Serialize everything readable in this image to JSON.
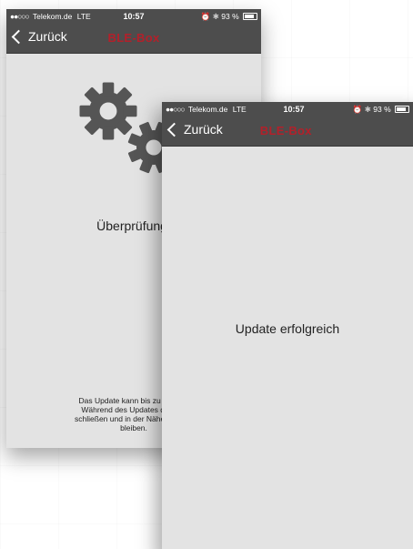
{
  "back_screen": {
    "status": {
      "signal_dots": "●●○○○",
      "carrier": "Telekom.de",
      "network": "LTE",
      "time": "10:57",
      "battery": "93 %"
    },
    "nav": {
      "back_label": "Zurück",
      "title": "BLE-Box"
    },
    "checking_text": "Überprüfung.",
    "note_lines": [
      "Das Update kann bis zu einer M",
      "Während des Updates die App",
      "schließen und in der Nähe der gev",
      "bleiben."
    ]
  },
  "front_screen": {
    "status": {
      "signal_dots": "●●○○○",
      "carrier": "Telekom.de",
      "network": "LTE",
      "time": "10:57",
      "battery": "93 %"
    },
    "nav": {
      "back_label": "Zurück",
      "title": "BLE-Box"
    },
    "success_text": "Update erfolgreich"
  },
  "colors": {
    "bar": "#4d4d4d",
    "title": "#b3202a",
    "content_bg": "#e3e3e3",
    "gear": "#555555"
  },
  "icons": {
    "back": "chevron-left-icon",
    "alarm": "alarm-clock-icon",
    "bluetooth": "bluetooth-icon",
    "battery": "battery-icon",
    "gears": "gears-icon"
  }
}
